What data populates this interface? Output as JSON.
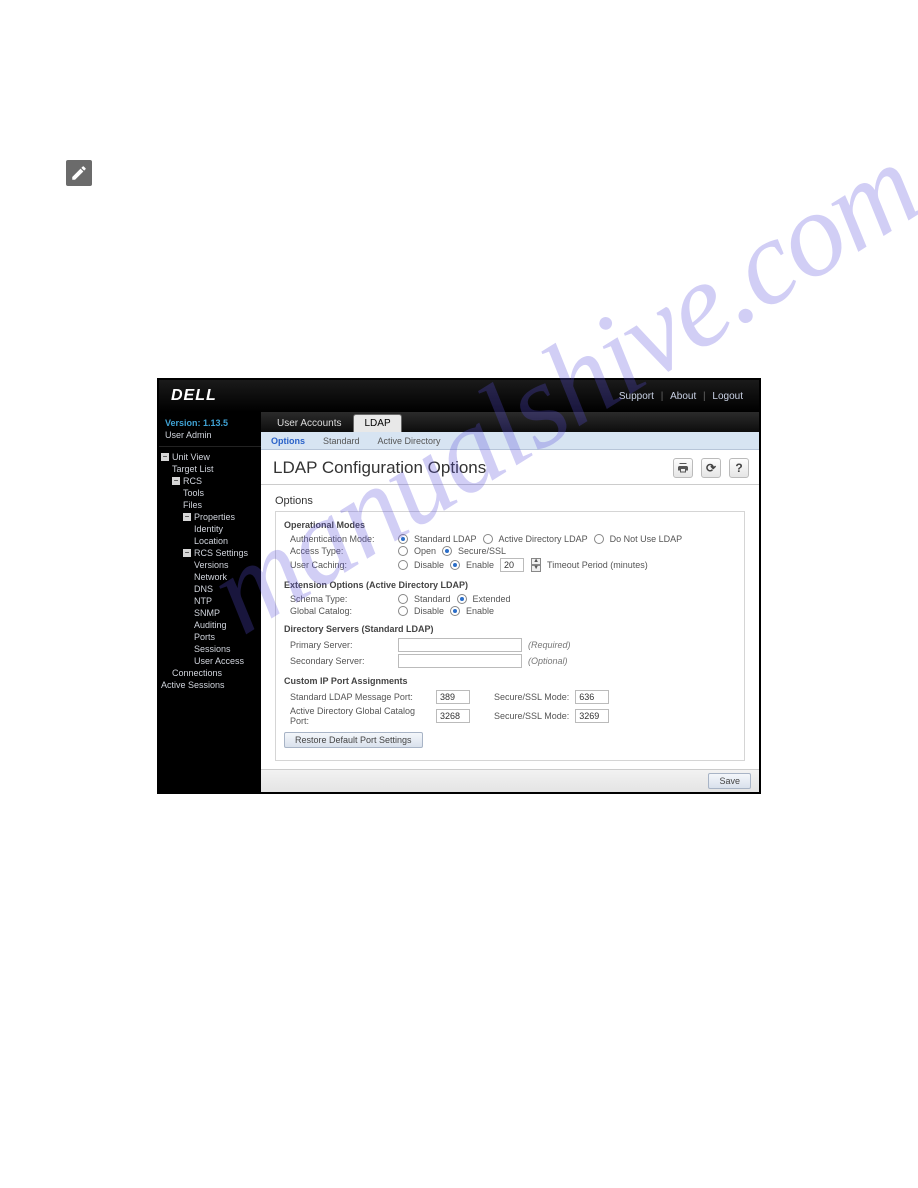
{
  "watermark": "manualshive.com",
  "brand": "DELL",
  "header_links": {
    "support": "Support",
    "about": "About",
    "logout": "Logout"
  },
  "sidebar": {
    "version_label": "Version: 1.13.5",
    "user": "User Admin",
    "tree": {
      "unit_view": "Unit View",
      "target_list": "Target List",
      "rcs": "RCS",
      "tools": "Tools",
      "files": "Files",
      "properties": "Properties",
      "identity": "Identity",
      "location": "Location",
      "rcs_settings": "RCS Settings",
      "versions": "Versions",
      "network": "Network",
      "dns": "DNS",
      "ntp": "NTP",
      "snmp": "SNMP",
      "auditing": "Auditing",
      "ports": "Ports",
      "sessions": "Sessions",
      "user_access": "User Access",
      "connections": "Connections",
      "active_sessions": "Active Sessions"
    }
  },
  "tabs": {
    "user_accounts": "User Accounts",
    "ldap": "LDAP"
  },
  "subtabs": {
    "options": "Options",
    "standard": "Standard",
    "active_directory": "Active Directory"
  },
  "title": "LDAP Configuration Options",
  "options_label": "Options",
  "groups": {
    "op_modes": "Operational Modes",
    "ext_opts": "Extension Options (Active Directory LDAP)",
    "dir_servers": "Directory Servers (Standard LDAP)",
    "custom_ports": "Custom IP Port Assignments"
  },
  "labels": {
    "auth_mode": "Authentication Mode:",
    "std_ldap": "Standard LDAP",
    "ad_ldap": "Active Directory LDAP",
    "no_ldap": "Do Not Use LDAP",
    "access_type": "Access Type:",
    "open": "Open",
    "secure": "Secure/SSL",
    "user_caching": "User Caching:",
    "disable": "Disable",
    "enable": "Enable",
    "timeout_period": "Timeout Period (minutes)",
    "schema_type": "Schema Type:",
    "standard": "Standard",
    "extended": "Extended",
    "global_catalog": "Global Catalog:",
    "primary_server": "Primary Server:",
    "secondary_server": "Secondary Server:",
    "required": "(Required)",
    "optional": "(Optional)",
    "std_port": "Standard LDAP Message Port:",
    "ad_port": "Active Directory Global Catalog Port:",
    "ssl_mode": "Secure/SSL Mode:"
  },
  "values": {
    "timeout": "20",
    "std_port": "389",
    "std_port_ssl": "636",
    "ad_port": "3268",
    "ad_port_ssl": "3269"
  },
  "buttons": {
    "restore": "Restore Default Port Settings",
    "save": "Save"
  }
}
